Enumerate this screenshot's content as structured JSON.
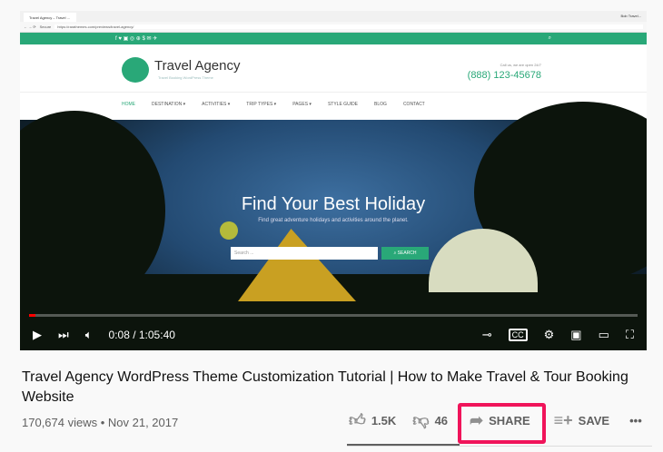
{
  "browser": {
    "tab": "Travel Agency – Travel ...",
    "window_user": "Bob Travel...",
    "secure": "Secure",
    "url": "https://rarathemes.com/previews/travel-agency/"
  },
  "site": {
    "social": "f ♥ ▣ ◎ ⊕ $ ✉ ✈",
    "brand": "Travel Agency",
    "tagline": "Travel Booking WordPress Theme",
    "callus": "Call us, we are open 24/7",
    "phone": "(888) 123-45678",
    "nav": [
      "HOME",
      "DESTINATION ▾",
      "ACTIVITIES ▾",
      "TRIP TYPES ▾",
      "PAGES ▾",
      "STYLE GUIDE",
      "BLOG",
      "CONTACT"
    ],
    "hero_title": "Find Your Best Holiday",
    "hero_sub": "Find great adventure holidays and activities around the planet.",
    "search_placeholder": "Search ...",
    "search_button": "⌕ SEARCH"
  },
  "player": {
    "time": "0:08 / 1:05:40",
    "progress_fraction": 0.002
  },
  "video": {
    "title": "Travel Agency WordPress Theme Customization Tutorial | How to Make Travel & Tour Booking Website",
    "views": "170,674 views • Nov 21, 2017",
    "likes": "1.5K",
    "dislikes": "46",
    "share": "SHARE",
    "save": "SAVE",
    "more": "•••"
  },
  "colors": {
    "brand": "#29a878",
    "highlight": "#f0145a"
  }
}
